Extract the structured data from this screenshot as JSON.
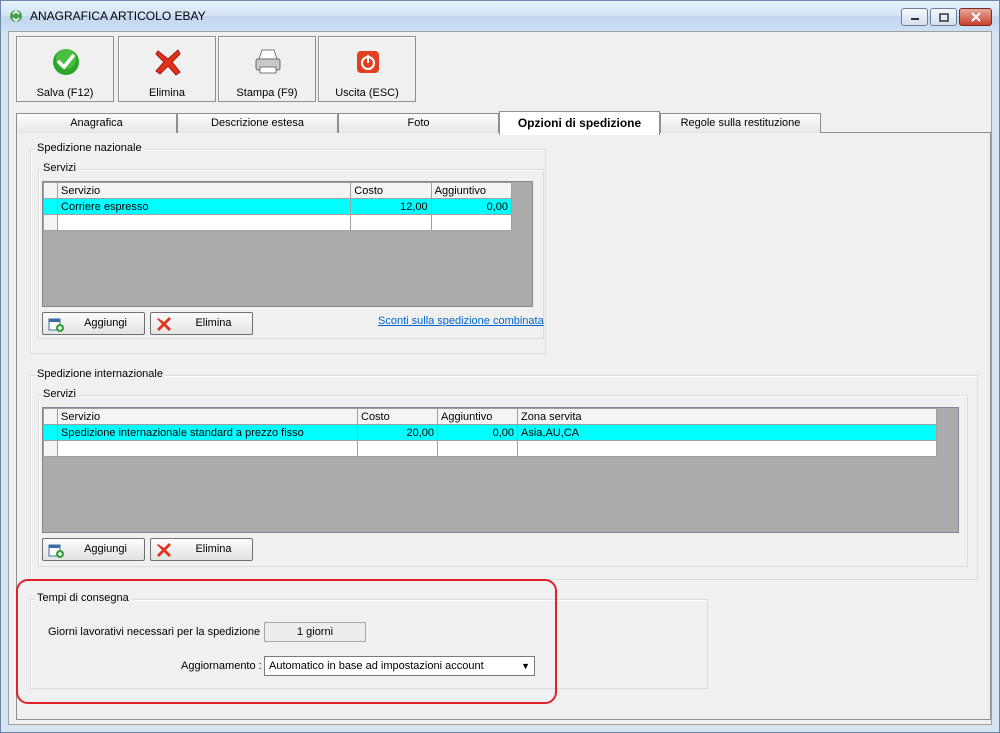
{
  "window": {
    "title": "ANAGRAFICA ARTICOLO EBAY",
    "icon": "recycle-app-icon"
  },
  "toolbar": {
    "save": {
      "label": "Salva (F12)",
      "icon": "checkmark-icon",
      "color": "#2aa52a"
    },
    "delete": {
      "label": "Elimina",
      "icon": "red-x-icon",
      "color": "#e0321e"
    },
    "print": {
      "label": "Stampa (F9)",
      "icon": "printer-icon"
    },
    "exit": {
      "label": "Uscita (ESC)",
      "icon": "power-icon",
      "color": "#e04020"
    }
  },
  "tabs": [
    {
      "label": "Anagrafica",
      "active": false
    },
    {
      "label": "Descrizione estesa",
      "active": false
    },
    {
      "label": "Foto",
      "active": false
    },
    {
      "label": "Opzioni di spedizione",
      "active": true
    },
    {
      "label": "Regole sulla restituzione",
      "active": false
    }
  ],
  "domestic": {
    "group_title": "Spedizione nazionale",
    "services_title": "Servizi",
    "columns": [
      "Servizio",
      "Costo",
      "Aggiuntivo"
    ],
    "rows": [
      {
        "servizio": "Corriere espresso",
        "costo": "12,00",
        "aggiuntivo": "0,00",
        "selected": true
      }
    ],
    "add_label": "Aggiungi",
    "delete_label": "Elimina",
    "combined_link": "Sconti sulla spedizione combinata"
  },
  "international": {
    "group_title": "Spedizione internazionale",
    "services_title": "Servizi",
    "columns": [
      "Servizio",
      "Costo",
      "Aggiuntivo",
      "Zona servita"
    ],
    "rows": [
      {
        "servizio": "Spedizione internazionale standard a prezzo fisso",
        "costo": "20,00",
        "aggiuntivo": "0,00",
        "zona": "Asia,AU,CA",
        "selected": true
      }
    ],
    "add_label": "Aggiungi",
    "delete_label": "Elimina"
  },
  "delivery": {
    "group_title": "Tempi di consegna",
    "days_label": "Giorni lavorativi necessari per la spedizione :",
    "days_value": "1 giorni",
    "update_label": "Aggiornamento :",
    "update_value": "Automatico in base ad impostazioni account"
  },
  "highlight_color": "#e0202a",
  "selection_color": "#00ffff"
}
